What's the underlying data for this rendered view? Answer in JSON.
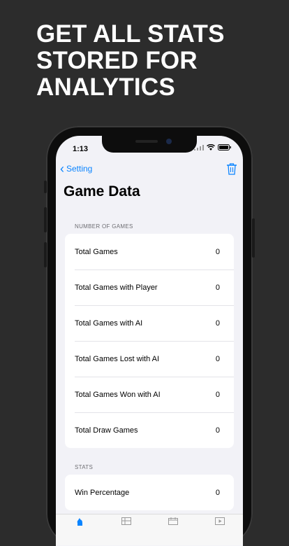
{
  "headline": "GET ALL STATS\nSTORED FOR\nANALYTICS",
  "status_bar": {
    "time": "1:13"
  },
  "nav": {
    "back_label": "Setting"
  },
  "page_title": "Game Data",
  "sections": {
    "games": {
      "header": "NUMBER OF GAMES",
      "rows": [
        {
          "label": "Total Games",
          "value": "0"
        },
        {
          "label": "Total Games with Player",
          "value": "0"
        },
        {
          "label": "Total Games with AI",
          "value": "0"
        },
        {
          "label": "Total Games Lost with AI",
          "value": "0"
        },
        {
          "label": "Total Games Won with AI",
          "value": "0"
        },
        {
          "label": "Total Draw Games",
          "value": "0"
        }
      ]
    },
    "stats": {
      "header": "STATS",
      "rows": [
        {
          "label": "Win Percentage",
          "value": "0"
        }
      ]
    }
  },
  "tabbar": {
    "items": [
      {
        "icon": "chess-knight-icon",
        "active": true
      },
      {
        "icon": "board-icon",
        "active": false
      },
      {
        "icon": "calendar-icon",
        "active": false
      },
      {
        "icon": "play-icon",
        "active": false
      }
    ]
  },
  "colors": {
    "accent": "#0a84ff",
    "background": "#2c2c2c",
    "screen": "#f2f2f7"
  }
}
